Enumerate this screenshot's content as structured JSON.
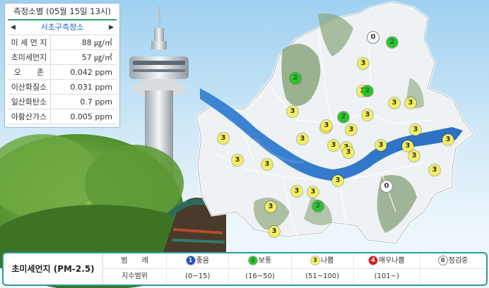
{
  "panel": {
    "header": "측정소별 (05월 15일 13시)",
    "station": "서초구측정소",
    "rows": [
      {
        "k": "미 세 먼 지",
        "v": "88 ㎍/㎥"
      },
      {
        "k": "초미세먼지",
        "v": "57 ㎍/㎥"
      },
      {
        "k": "오　　존",
        "v": "0.042 ppm"
      },
      {
        "k": "이산화질소",
        "v": "0.031 ppm"
      },
      {
        "k": "일산화탄소",
        "v": "0.7 ppm"
      },
      {
        "k": "아황산가스",
        "v": "0.005 ppm"
      }
    ]
  },
  "map": {
    "badges": [
      "0",
      "2",
      "3",
      "2",
      "3",
      "3",
      "3",
      "2",
      "3",
      "3",
      "3",
      "3",
      "3",
      "3",
      "3",
      "3",
      "3",
      "3",
      "3",
      "3",
      "3",
      "3",
      "0",
      "3",
      "3",
      "2",
      "3",
      "3",
      "3",
      "3",
      "3",
      "2",
      "3",
      "3"
    ]
  },
  "legend": {
    "title": "초미세먼지 (PM-2.5)",
    "head_label": "범　　례",
    "range_label": "지수범위",
    "items": [
      {
        "num": "1",
        "label": "좋음",
        "range": "(0~15)"
      },
      {
        "num": "2",
        "label": "보통",
        "range": "(16~50)"
      },
      {
        "num": "3",
        "label": "나쁨",
        "range": "(51~100)"
      },
      {
        "num": "4",
        "label": "매우나쁨",
        "range": "(101~)"
      },
      {
        "num": "0",
        "label": "점검중",
        "range": ""
      }
    ]
  },
  "colors": {
    "good": "#1d52c9",
    "normal": "#2fc12f",
    "bad": "#f3f060",
    "very_bad": "#d41a1a",
    "check": "#ffffff"
  }
}
